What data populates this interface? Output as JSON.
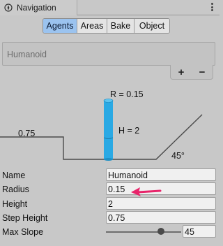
{
  "window": {
    "tab_title": "Navigation",
    "menu_icon": "kebab-menu-icon",
    "tab_icon": "navigation-compass-icon"
  },
  "segmented": {
    "tabs": [
      {
        "label": "Agents",
        "active": true
      },
      {
        "label": "Areas",
        "active": false
      },
      {
        "label": "Bake",
        "active": false
      },
      {
        "label": "Object",
        "active": false
      }
    ]
  },
  "agent_list": {
    "items": [
      "Humanoid"
    ],
    "add_label": "+",
    "remove_label": "−"
  },
  "diagram": {
    "radius_label": "R = 0.15",
    "height_label": "H = 2",
    "step_label": "0.75",
    "slope_label": "45°",
    "agent_color": "#29a9e4",
    "slope_value_deg": 45
  },
  "properties": {
    "name": {
      "label": "Name",
      "value": "Humanoid"
    },
    "radius": {
      "label": "Radius",
      "value": "0.15"
    },
    "height": {
      "label": "Height",
      "value": "2"
    },
    "step_height": {
      "label": "Step Height",
      "value": "0.75"
    },
    "max_slope": {
      "label": "Max Slope",
      "value": "45",
      "min": 0,
      "max": 60
    }
  },
  "annotation": {
    "arrow_color": "#e8246a"
  }
}
